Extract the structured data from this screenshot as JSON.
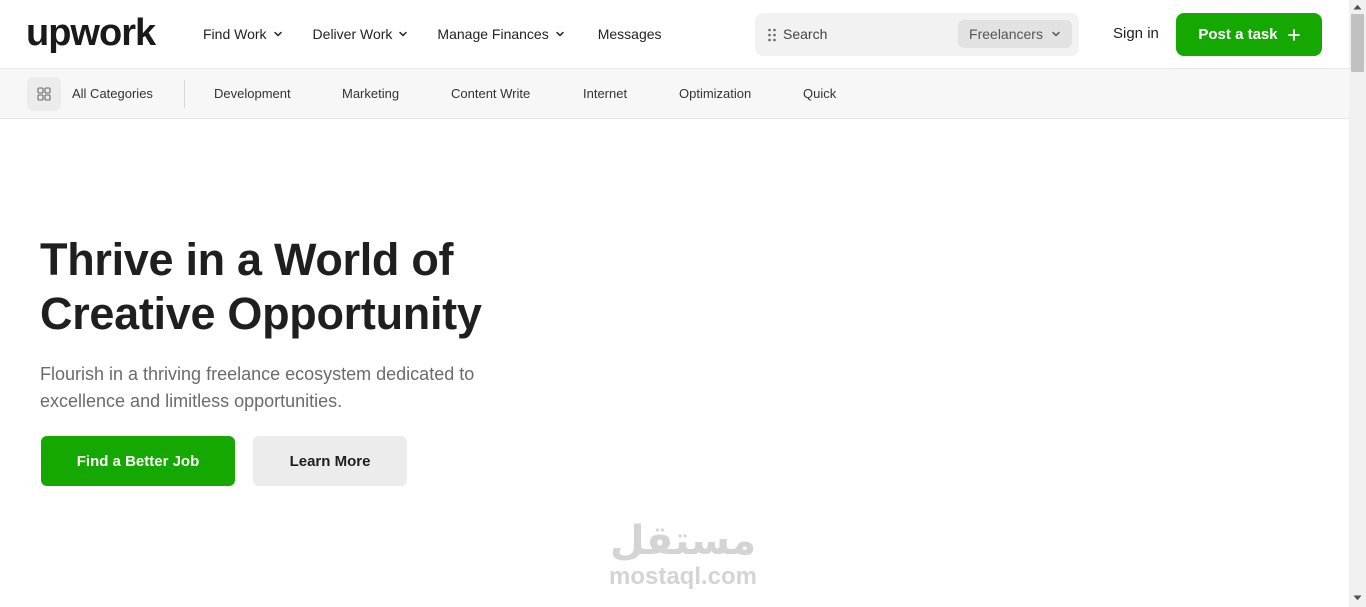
{
  "header": {
    "logo": "upwork",
    "nav": [
      {
        "label": "Find Work",
        "dropdown": true
      },
      {
        "label": "Deliver Work",
        "dropdown": true
      },
      {
        "label": "Manage Finances",
        "dropdown": true
      },
      {
        "label": "Messages",
        "dropdown": false
      }
    ],
    "search": {
      "placeholder": "Search",
      "scope": "Freelancers"
    },
    "signin": "Sign in",
    "post_task": "Post a task"
  },
  "categories": {
    "all_label": "All Categories",
    "items": [
      "Development",
      "Marketing",
      "Content Write",
      "Internet",
      "Optimization",
      "Quick"
    ]
  },
  "hero": {
    "title_line1": "Thrive in a World of",
    "title_line2": "Creative Opportunity",
    "subtitle_line1": "Flourish in a thriving freelance ecosystem dedicated to",
    "subtitle_line2": "excellence and limitless opportunities.",
    "primary_button": "Find a Better Job",
    "secondary_button": "Learn More"
  },
  "watermark": {
    "arabic": "مستقل",
    "latin": "mostaql.com"
  },
  "colors": {
    "brand_green": "#14a800",
    "text_dark": "#1f1f1f",
    "text_muted": "#6b6b6b"
  }
}
